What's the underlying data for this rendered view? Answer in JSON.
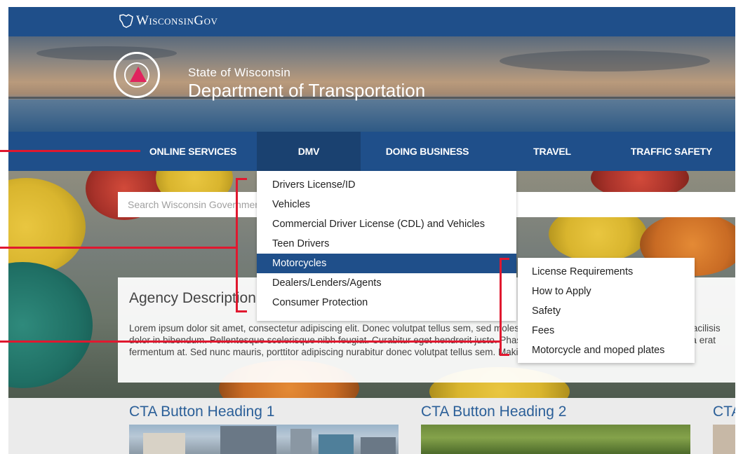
{
  "topbar": {
    "logo_text": "WisconsinGov"
  },
  "header": {
    "state": "State of Wisconsin",
    "department": "Department of Transportation"
  },
  "nav": {
    "items": [
      {
        "label": "ONLINE SERVICES"
      },
      {
        "label": "DMV"
      },
      {
        "label": "DOING BUSINESS"
      },
      {
        "label": "TRAVEL"
      },
      {
        "label": "TRAFFIC SAFETY"
      }
    ],
    "active": "DMV"
  },
  "search": {
    "placeholder": "Search Wisconsin Government"
  },
  "dmv_menu": {
    "items": [
      {
        "label": "Drivers License/ID"
      },
      {
        "label": "Vehicles"
      },
      {
        "label": "Commercial Driver License (CDL) and Vehicles"
      },
      {
        "label": "Teen Drivers"
      },
      {
        "label": "Motorcycles"
      },
      {
        "label": "Dealers/Lenders/Agents"
      },
      {
        "label": "Consumer Protection"
      }
    ],
    "active": "Motorcycles"
  },
  "motorcycle_submenu": {
    "items": [
      {
        "label": "License Requirements"
      },
      {
        "label": "How to Apply"
      },
      {
        "label": "Safety"
      },
      {
        "label": "Fees"
      },
      {
        "label": "Motorcycle and moped plates"
      }
    ]
  },
  "agency": {
    "title": "Agency Description",
    "body": "Lorem ipsum dolor sit amet, consectetur adipiscing elit. Donec volutpat tellus sem, sed molestie nunc pretium sit amet. Proin vehicula facilisis dolor in bibendum. Pellentesque scelerisque nibh feugiat. Curabitur eget hendrerit justo. Phasellus pretium aliquam mauris, mattis porta erat fermentum at. Sed nunc mauris, porttitor adipiscing nurabitur donec volutpat tellus sem. Making a super awesome content change."
  },
  "cta": [
    {
      "heading": "CTA Button Heading 1"
    },
    {
      "heading": "CTA Button Heading 2"
    },
    {
      "heading": "CTA"
    }
  ],
  "colors": {
    "nav_blue": "#1f4f8a",
    "nav_active": "#1a4170",
    "annotation_red": "#e0182f",
    "cta_heading": "#2b5f98"
  }
}
